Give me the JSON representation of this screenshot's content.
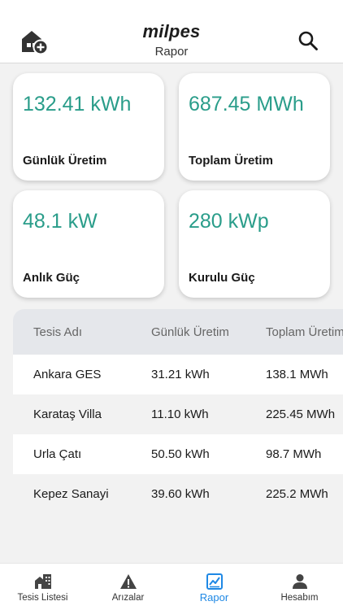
{
  "header": {
    "brand": "milpes",
    "subtitle": "Rapor",
    "add_icon": "home-add-icon",
    "search_icon": "search-icon"
  },
  "cards": [
    {
      "value": "132.41 kWh",
      "label": "Günlük Üretim"
    },
    {
      "value": "687.45 MWh",
      "label": "Toplam Üretim"
    },
    {
      "value": "48.1 kW",
      "label": "Anlık Güç"
    },
    {
      "value": "280 kWp",
      "label": "Kurulu Güç"
    }
  ],
  "table": {
    "headers": [
      "Tesis Adı",
      "Günlük Üretim",
      "Toplam Üretim"
    ],
    "rows": [
      [
        "Ankara GES",
        "31.21 kWh",
        "138.1 MWh"
      ],
      [
        "Karataş Villa",
        "11.10 kWh",
        "225.45 MWh"
      ],
      [
        "Urla Çatı",
        "50.50 kWh",
        "98.7 MWh"
      ],
      [
        "Kepez Sanayi",
        "39.60 kWh",
        "225.2 MWh"
      ]
    ]
  },
  "nav": [
    {
      "label": "Tesis Listesi",
      "icon": "buildings-icon"
    },
    {
      "label": "Arızalar",
      "icon": "warning-icon"
    },
    {
      "label": "Rapor",
      "icon": "chart-icon",
      "active": true
    },
    {
      "label": "Hesabım",
      "icon": "person-icon"
    }
  ],
  "colors": {
    "accent": "#2a9d8a",
    "nav_active": "#1e88e5",
    "table_head_bg": "#e5e7eb"
  }
}
